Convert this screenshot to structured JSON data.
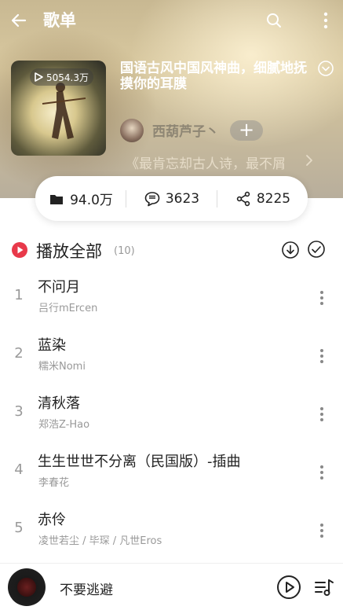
{
  "header": {
    "title": "歌单"
  },
  "playlist": {
    "title": "国语古风中国风神曲，细腻地抚摸你的耳膜",
    "play_count": "5054.3万",
    "creator": "西葫芦子丶",
    "follow_label": "+",
    "description": "《最肯忘却古人诗，最不屑"
  },
  "stats": {
    "collect": "94.0万",
    "comments": "3623",
    "shares": "8225"
  },
  "play_all": {
    "label": "播放全部",
    "count": "(10)"
  },
  "songs": [
    {
      "index": "1",
      "title": "不问月",
      "artist": "吕行mErcen"
    },
    {
      "index": "2",
      "title": "蓝染",
      "artist": "糯米Nomi"
    },
    {
      "index": "3",
      "title": "清秋落",
      "artist": "郑浩Z-Hao"
    },
    {
      "index": "4",
      "title": "生生世世不分离（民国版）-插曲",
      "artist": "李春花"
    },
    {
      "index": "5",
      "title": "赤伶",
      "artist": "凌世若尘 / 毕琛 / 凡世Eros"
    }
  ],
  "now_playing": {
    "title": "不要逃避"
  },
  "colors": {
    "accent": "#e8394a",
    "text": "#222222",
    "muted": "#999999"
  }
}
